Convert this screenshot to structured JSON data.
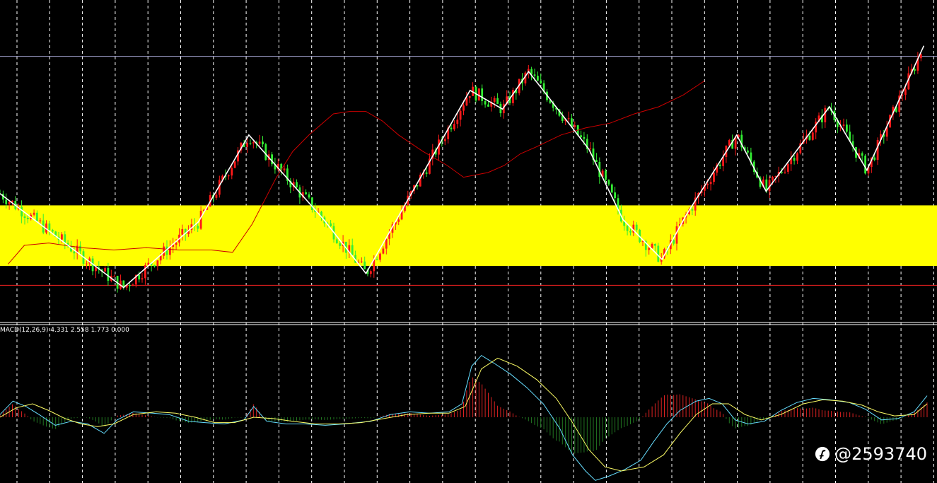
{
  "colors": {
    "background": "#000000",
    "grid": "#ffffff",
    "zone": "#ffff00",
    "bull_candle": "#ff1a1a",
    "bear_candle": "#33ee33",
    "zigzag": "#ffffff",
    "moving_average": "#cc0000",
    "support_line": "#ff2222",
    "resistance_line": "#b0b0e0",
    "macd_line": "#66ddff",
    "signal_line": "#ffff66",
    "hist_positive": "#dd2222",
    "hist_negative": "#227722"
  },
  "chart_data": [
    {
      "type": "candlestick",
      "price_range": [
        0,
        100
      ],
      "time_range": [
        0,
        300
      ],
      "grid": "vertical-dashed",
      "zone": {
        "low": 7.2,
        "high": 33
      },
      "horizontal_lines": [
        {
          "role": "support",
          "value": -1
        },
        {
          "role": "resistance",
          "value": 96.5
        }
      ],
      "zigzag": [
        [
          0,
          38
        ],
        [
          36,
          19
        ],
        [
          76,
          -2
        ],
        [
          122,
          26
        ],
        [
          153,
          63
        ],
        [
          199,
          27
        ],
        [
          225,
          4
        ],
        [
          289,
          82
        ],
        [
          309,
          74
        ],
        [
          325,
          90
        ],
        [
          362,
          57
        ],
        [
          383,
          27
        ],
        [
          407,
          10
        ],
        [
          422,
          29
        ],
        [
          453,
          63
        ],
        [
          471,
          39
        ],
        [
          510,
          75
        ],
        [
          533,
          48
        ],
        [
          568,
          101
        ]
      ],
      "moving_average": [
        [
          5,
          8
        ],
        [
          15,
          16
        ],
        [
          30,
          17
        ],
        [
          50,
          15
        ],
        [
          70,
          14
        ],
        [
          90,
          15
        ],
        [
          110,
          14
        ],
        [
          130,
          14
        ],
        [
          143,
          13
        ],
        [
          155,
          25
        ],
        [
          170,
          45
        ],
        [
          180,
          56
        ],
        [
          190,
          63
        ],
        [
          205,
          72
        ],
        [
          215,
          73
        ],
        [
          225,
          73
        ],
        [
          235,
          69
        ],
        [
          245,
          63
        ],
        [
          260,
          56
        ],
        [
          275,
          50
        ],
        [
          285,
          45
        ],
        [
          300,
          47
        ],
        [
          310,
          50
        ],
        [
          320,
          55
        ],
        [
          330,
          58
        ],
        [
          345,
          63
        ],
        [
          360,
          66
        ],
        [
          375,
          68
        ],
        [
          390,
          72
        ],
        [
          405,
          75
        ],
        [
          420,
          80
        ],
        [
          433,
          86
        ]
      ]
    },
    {
      "type": "macd",
      "label": "MACD(12,26,9) 4.331 2.558 1.773 0.000",
      "params": [
        12,
        26,
        9
      ],
      "values": {
        "macd": 4.331,
        "signal": 2.558,
        "histogram": 1.773,
        "zero": 0.0
      },
      "macd_line": [
        [
          0,
          2
        ],
        [
          8,
          12
        ],
        [
          16,
          8
        ],
        [
          24,
          2
        ],
        [
          34,
          -6
        ],
        [
          44,
          -3
        ],
        [
          54,
          -5
        ],
        [
          64,
          -12
        ],
        [
          72,
          -2
        ],
        [
          82,
          4
        ],
        [
          94,
          3
        ],
        [
          104,
          2
        ],
        [
          116,
          -3
        ],
        [
          126,
          -4
        ],
        [
          138,
          -5
        ],
        [
          150,
          -2
        ],
        [
          156,
          8
        ],
        [
          164,
          -3
        ],
        [
          176,
          -5
        ],
        [
          188,
          -5
        ],
        [
          200,
          -6
        ],
        [
          212,
          -5
        ],
        [
          228,
          -3
        ],
        [
          240,
          2
        ],
        [
          252,
          4
        ],
        [
          264,
          3
        ],
        [
          276,
          4
        ],
        [
          284,
          10
        ],
        [
          290,
          38
        ],
        [
          296,
          46
        ],
        [
          304,
          40
        ],
        [
          314,
          32
        ],
        [
          324,
          22
        ],
        [
          334,
          10
        ],
        [
          344,
          -8
        ],
        [
          352,
          -28
        ],
        [
          360,
          -40
        ],
        [
          366,
          -47
        ],
        [
          374,
          -44
        ],
        [
          384,
          -39
        ],
        [
          394,
          -32
        ],
        [
          402,
          -18
        ],
        [
          410,
          -5
        ],
        [
          418,
          5
        ],
        [
          428,
          12
        ],
        [
          436,
          14
        ],
        [
          444,
          10
        ],
        [
          452,
          -2
        ],
        [
          460,
          -5
        ],
        [
          470,
          -3
        ],
        [
          480,
          5
        ],
        [
          490,
          11
        ],
        [
          500,
          14
        ],
        [
          510,
          13
        ],
        [
          522,
          11
        ],
        [
          532,
          6
        ],
        [
          542,
          -2
        ],
        [
          552,
          -1
        ],
        [
          562,
          4
        ],
        [
          570,
          16
        ]
      ],
      "signal_line": [
        [
          0,
          0
        ],
        [
          10,
          7
        ],
        [
          20,
          10
        ],
        [
          30,
          5
        ],
        [
          40,
          -1
        ],
        [
          50,
          -5
        ],
        [
          60,
          -7
        ],
        [
          70,
          -5
        ],
        [
          82,
          2
        ],
        [
          96,
          4
        ],
        [
          108,
          3
        ],
        [
          120,
          0
        ],
        [
          132,
          -4
        ],
        [
          144,
          -4
        ],
        [
          156,
          0
        ],
        [
          168,
          -1
        ],
        [
          180,
          -3
        ],
        [
          194,
          -5
        ],
        [
          208,
          -5
        ],
        [
          222,
          -4
        ],
        [
          236,
          -1
        ],
        [
          250,
          2
        ],
        [
          264,
          3
        ],
        [
          276,
          3
        ],
        [
          286,
          8
        ],
        [
          296,
          36
        ],
        [
          306,
          44
        ],
        [
          318,
          38
        ],
        [
          330,
          28
        ],
        [
          342,
          14
        ],
        [
          352,
          -4
        ],
        [
          362,
          -24
        ],
        [
          372,
          -37
        ],
        [
          382,
          -40
        ],
        [
          396,
          -37
        ],
        [
          408,
          -28
        ],
        [
          418,
          -12
        ],
        [
          428,
          2
        ],
        [
          438,
          10
        ],
        [
          448,
          10
        ],
        [
          458,
          2
        ],
        [
          468,
          -2
        ],
        [
          480,
          2
        ],
        [
          494,
          10
        ],
        [
          506,
          13
        ],
        [
          518,
          12
        ],
        [
          530,
          9
        ],
        [
          540,
          4
        ],
        [
          550,
          1
        ],
        [
          562,
          2
        ],
        [
          570,
          10
        ]
      ]
    }
  ],
  "watermark": {
    "icon": "feather-logo-icon",
    "text": "@2593740"
  }
}
